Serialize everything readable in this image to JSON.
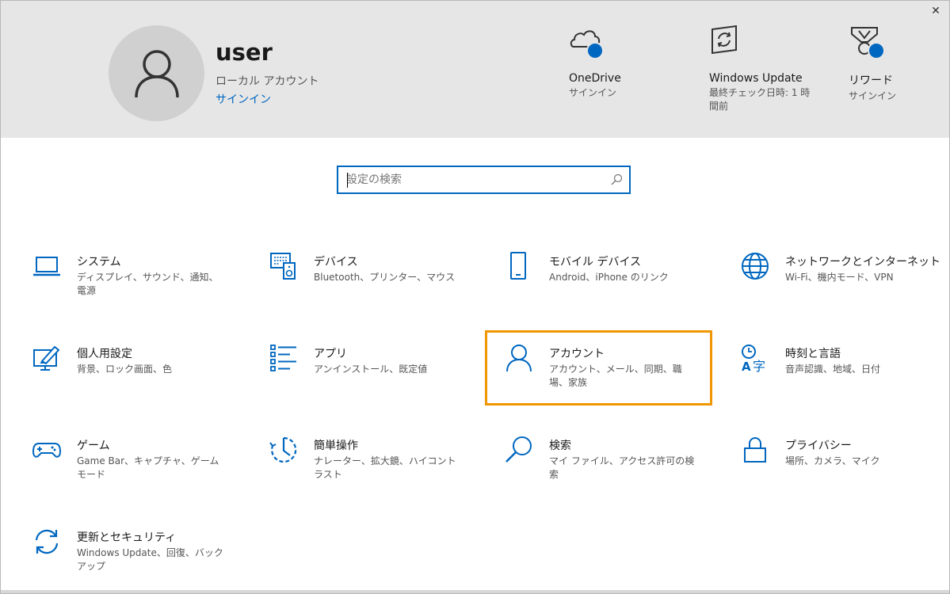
{
  "window": {
    "close_label": "✕"
  },
  "user": {
    "name": "user",
    "account_type": "ローカル アカウント",
    "signin_link": "サインイン"
  },
  "header_items": [
    {
      "icon": "onedrive-icon",
      "title": "OneDrive",
      "subtitle": "サインイン"
    },
    {
      "icon": "windows-update-icon",
      "title": "Windows Update",
      "subtitle": "最終チェック日時: 1 時間前"
    },
    {
      "icon": "rewards-icon",
      "title": "リワード",
      "subtitle": "サインイン"
    }
  ],
  "search": {
    "placeholder": "設定の検索",
    "icon": "search-icon"
  },
  "tiles": [
    {
      "icon": "laptop-icon",
      "title": "システム",
      "desc": "ディスプレイ、サウンド、通知、電源"
    },
    {
      "icon": "devices-icon",
      "title": "デバイス",
      "desc": "Bluetooth、プリンター、マウス"
    },
    {
      "icon": "phone-icon",
      "title": "モバイル デバイス",
      "desc": "Android、iPhone のリンク"
    },
    {
      "icon": "globe-icon",
      "title": "ネットワークとインターネット",
      "desc": "Wi-Fi、機内モード、VPN"
    },
    {
      "icon": "personalization-icon",
      "title": "個人用設定",
      "desc": "背景、ロック画面、色"
    },
    {
      "icon": "apps-icon",
      "title": "アプリ",
      "desc": "アンインストール、既定値"
    },
    {
      "icon": "account-icon",
      "title": "アカウント",
      "desc": "アカウント、メール、同期、職場、家族"
    },
    {
      "icon": "time-language-icon",
      "title": "時刻と言語",
      "desc": "音声認識、地域、日付"
    },
    {
      "icon": "gamepad-icon",
      "title": "ゲーム",
      "desc": "Game Bar、キャプチャ、ゲーム モード"
    },
    {
      "icon": "ease-of-access-icon",
      "title": "簡単操作",
      "desc": "ナレーター、拡大鏡、ハイコントラスト"
    },
    {
      "icon": "search-tile-icon",
      "title": "検索",
      "desc": "マイ ファイル、アクセス許可の検索"
    },
    {
      "icon": "privacy-lock-icon",
      "title": "プライバシー",
      "desc": "場所、カメラ、マイク"
    },
    {
      "icon": "update-security-icon",
      "title": "更新とセキュリティ",
      "desc": "Windows Update、回復、バックアップ"
    }
  ],
  "colors": {
    "accent": "#0067c0",
    "highlight": "#f09600",
    "header_bg": "#e6e6e6"
  }
}
